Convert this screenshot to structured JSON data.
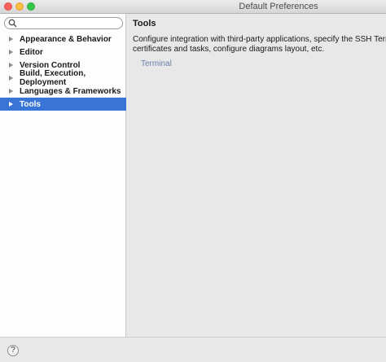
{
  "window": {
    "title": "Default Preferences"
  },
  "search": {
    "placeholder": "",
    "value": ""
  },
  "sidebar": {
    "items": [
      {
        "label": "Appearance & Behavior",
        "selected": false
      },
      {
        "label": "Editor",
        "selected": false
      },
      {
        "label": "Version Control",
        "selected": false
      },
      {
        "label": "Build, Execution, Deployment",
        "selected": false
      },
      {
        "label": "Languages & Frameworks",
        "selected": false
      },
      {
        "label": "Tools",
        "selected": true
      }
    ]
  },
  "main": {
    "heading": "Tools",
    "description_line1": "Configure integration with third-party applications, specify the SSH Terminal",
    "description_line2": "certificates and tasks, configure diagrams layout, etc.",
    "link_terminal": "Terminal"
  },
  "footer": {
    "help_label": "?"
  },
  "colors": {
    "selection": "#3875d7",
    "link": "#6b7fb0"
  }
}
